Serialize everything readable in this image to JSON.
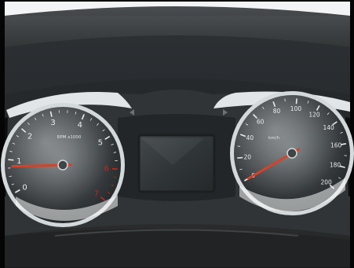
{
  "tachometer": {
    "unit_label": "RPM x1000",
    "ticks": [
      "0",
      "1",
      "2",
      "3",
      "4",
      "5",
      "6",
      "7"
    ],
    "needle_value": 0.8
  },
  "speedometer": {
    "unit_label": "km/h",
    "ticks": [
      "0",
      "20",
      "40",
      "60",
      "80",
      "100",
      "120",
      "140",
      "160",
      "180",
      "200"
    ],
    "needle_value": 0
  },
  "center_display": {
    "state": "off"
  },
  "indicators": {
    "left_turn": "left-arrow-icon",
    "right_turn": "right-arrow-icon"
  },
  "colors": {
    "needle": "#e03a1e",
    "redline": "#c81e14",
    "dashboard": "#262829",
    "chrome": "#dfe3e6"
  }
}
